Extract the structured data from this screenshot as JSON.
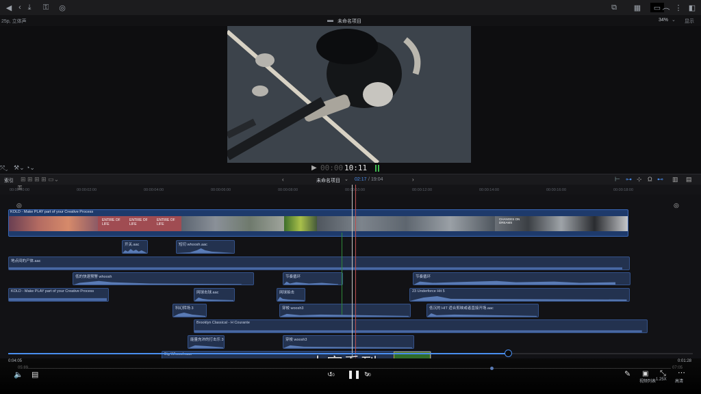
{
  "topbar": {
    "icons": [
      "back-arrow-icon",
      "download-icon",
      "key-icon",
      "check-circle-icon",
      "library-icon",
      "grid-icon",
      "headphones-icon",
      "more-icon",
      "sidebar-icon"
    ]
  },
  "subbar": {
    "format_label": "25p, 立体声",
    "project_title": "未命名项目",
    "zoom": "34%",
    "display_label": "显示"
  },
  "viewer": {
    "timecode_dim": "00:00",
    "timecode": "10:11"
  },
  "timeline_toolbar": {
    "index_label": "索引",
    "project_name": "未命名项目",
    "position": "02:17",
    "duration": "19:04"
  },
  "ruler_ticks": [
    "00:00:00:00",
    "00:00:02:00",
    "00:00:04:00",
    "00:00:06:00",
    "00:00:08:00",
    "00:00:10:00",
    "00:00:12:00",
    "00:00:14:00",
    "00:00:16:00",
    "00:00:18:00"
  ],
  "video_clip": {
    "name": "KOLD - Make PLAY part of your Creative Process",
    "thumb_texts": [
      "ENTIRE OF LIFE",
      "ENTIRE OF LIFE",
      "ENTIRE OF LIFE",
      "CHANGES ON DREAMS"
    ]
  },
  "audio_clips": [
    {
      "name": "开关.aac"
    },
    {
      "name": "短切 whoosh.aac"
    },
    {
      "name": "地点间的尸体.aac"
    },
    {
      "name": "低的快速预警 whoosh"
    },
    {
      "name": "节奏循环"
    },
    {
      "name": "节奏循环"
    },
    {
      "name": "KOLD - Make PLAY part of your Creative Process"
    },
    {
      "name": "网球击球.aac"
    },
    {
      "name": "网球拍击"
    },
    {
      "name": "23 Underforce Hit 5"
    },
    {
      "name": "科幻转场 3"
    },
    {
      "name": "穿梭 woosh3"
    },
    {
      "name": "低沉的 HIT 适合剪映或者直接开场.aac"
    },
    {
      "name": "Brooklyn Classical - H Courante"
    },
    {
      "name": "能量充沛的打击乐 3"
    },
    {
      "name": "穿梭 woosh3"
    },
    {
      "name": "Big Whoosh.aac"
    }
  ],
  "player": {
    "current_time": "0:04:05",
    "total_time": "0:01:28",
    "lower_left_time": "05:89",
    "lower_right_time": "07:05",
    "caption": "大家看到",
    "skip_back": "10",
    "skip_forward": "30",
    "playlist_label": "视频列表",
    "speed_label": "1.25X",
    "quality_label": "高清",
    "progress": 0.73
  },
  "colors": {
    "accent": "#4a8ff0",
    "audio_clip": "#23324f",
    "video_clip": "#1e3a6b",
    "timecode_green": "#3fb950"
  }
}
